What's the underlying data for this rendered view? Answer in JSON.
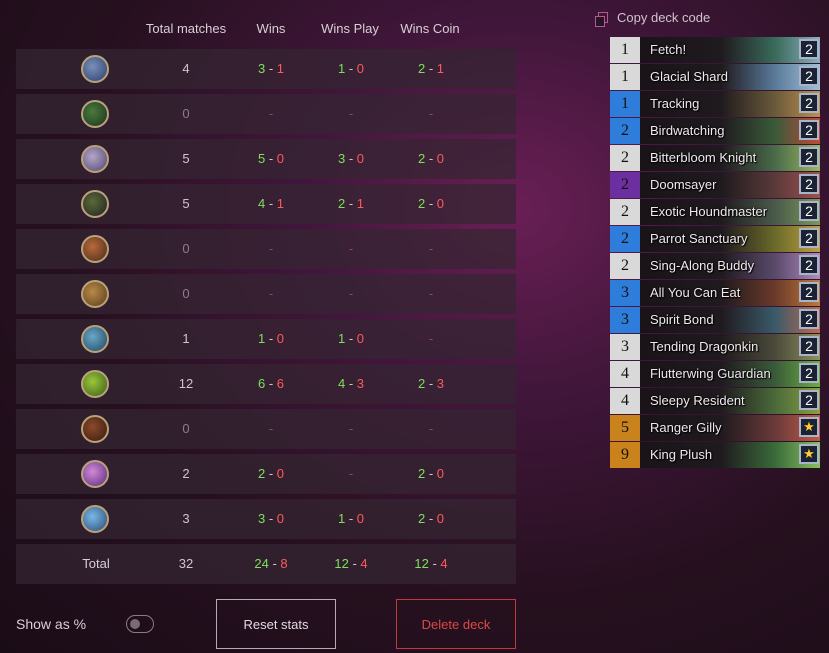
{
  "table": {
    "headers": {
      "total": "Total matches",
      "wins": "Wins",
      "wins_play": "Wins Play",
      "wins_coin": "Wins Coin"
    },
    "rows": [
      {
        "hero_icon": "hunter-icon-a",
        "total": "4",
        "wins": [
          "3",
          "1"
        ],
        "play": [
          "1",
          "0"
        ],
        "coin": [
          "2",
          "1"
        ]
      },
      {
        "hero_icon": "hunter-icon-b",
        "total": "0",
        "wins": "-",
        "play": "-",
        "coin": "-"
      },
      {
        "hero_icon": "mage-icon",
        "total": "5",
        "wins": [
          "5",
          "0"
        ],
        "play": [
          "3",
          "0"
        ],
        "coin": [
          "2",
          "0"
        ]
      },
      {
        "hero_icon": "rogue-icon",
        "total": "5",
        "wins": [
          "4",
          "1"
        ],
        "play": [
          "2",
          "1"
        ],
        "coin": [
          "2",
          "0"
        ]
      },
      {
        "hero_icon": "warrior-icon",
        "total": "0",
        "wins": "-",
        "play": "-",
        "coin": "-"
      },
      {
        "hero_icon": "shaman-icon",
        "total": "0",
        "wins": "-",
        "play": "-",
        "coin": "-"
      },
      {
        "hero_icon": "priest-icon",
        "total": "1",
        "wins": [
          "1",
          "0"
        ],
        "play": [
          "1",
          "0"
        ],
        "coin": "-"
      },
      {
        "hero_icon": "druid-icon",
        "total": "12",
        "wins": [
          "6",
          "6"
        ],
        "play": [
          "4",
          "3"
        ],
        "coin": [
          "2",
          "3"
        ]
      },
      {
        "hero_icon": "warlock-icon",
        "total": "0",
        "wins": "-",
        "play": "-",
        "coin": "-"
      },
      {
        "hero_icon": "demonhunter-icon",
        "total": "2",
        "wins": [
          "2",
          "0"
        ],
        "play": "-",
        "coin": [
          "2",
          "0"
        ]
      },
      {
        "hero_icon": "paladin-icon",
        "total": "3",
        "wins": [
          "3",
          "0"
        ],
        "play": [
          "1",
          "0"
        ],
        "coin": [
          "2",
          "0"
        ]
      }
    ],
    "total_row": {
      "label": "Total",
      "total": "32",
      "wins": [
        "24",
        "8"
      ],
      "play": [
        "12",
        "4"
      ],
      "coin": [
        "12",
        "4"
      ]
    }
  },
  "controls": {
    "show_pct_label": "Show as %",
    "reset_label": "Reset stats",
    "delete_label": "Delete deck"
  },
  "deck": {
    "copy_label": "Copy deck code",
    "cards": [
      {
        "cost": "1",
        "name": "Fetch!",
        "count": "2",
        "rarity": "common"
      },
      {
        "cost": "1",
        "name": "Glacial Shard",
        "count": "2",
        "rarity": "common"
      },
      {
        "cost": "1",
        "name": "Tracking",
        "count": "2",
        "rarity": "rare"
      },
      {
        "cost": "2",
        "name": "Birdwatching",
        "count": "2",
        "rarity": "rare"
      },
      {
        "cost": "2",
        "name": "Bitterbloom Knight",
        "count": "2",
        "rarity": "common"
      },
      {
        "cost": "2",
        "name": "Doomsayer",
        "count": "2",
        "rarity": "epic"
      },
      {
        "cost": "2",
        "name": "Exotic Houndmaster",
        "count": "2",
        "rarity": "common"
      },
      {
        "cost": "2",
        "name": "Parrot Sanctuary",
        "count": "2",
        "rarity": "rare"
      },
      {
        "cost": "2",
        "name": "Sing-Along Buddy",
        "count": "2",
        "rarity": "common"
      },
      {
        "cost": "3",
        "name": "All You Can Eat",
        "count": "2",
        "rarity": "rare"
      },
      {
        "cost": "3",
        "name": "Spirit Bond",
        "count": "2",
        "rarity": "rare"
      },
      {
        "cost": "3",
        "name": "Tending Dragonkin",
        "count": "2",
        "rarity": "common"
      },
      {
        "cost": "4",
        "name": "Flutterwing Guardian",
        "count": "2",
        "rarity": "common"
      },
      {
        "cost": "4",
        "name": "Sleepy Resident",
        "count": "2",
        "rarity": "common"
      },
      {
        "cost": "5",
        "name": "Ranger Gilly",
        "count": "★",
        "rarity": "legendary"
      },
      {
        "cost": "9",
        "name": "King Plush",
        "count": "★",
        "rarity": "legendary"
      }
    ]
  },
  "colors": {
    "win": "#7de05a",
    "loss": "#ff5a5a",
    "delete": "#e04848",
    "rarity_common": "#d9d9d9",
    "rarity_rare": "#2e7ddb",
    "rarity_epic": "#6b2fa0",
    "rarity_legendary": "#c9821c"
  }
}
